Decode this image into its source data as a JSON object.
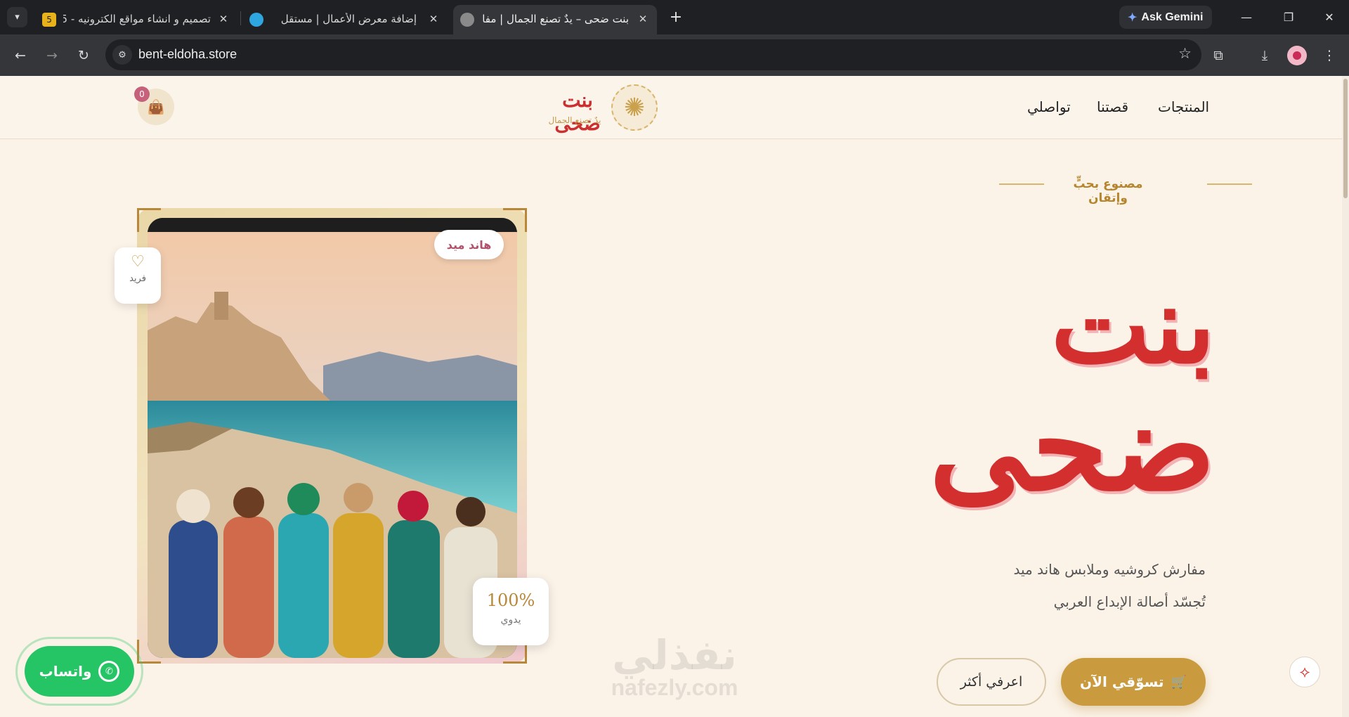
{
  "browser": {
    "tab_list_icon": "chevron-down-icon",
    "tabs": [
      {
        "title": "تصميم و انشاء مواقع الكترونيه - 5",
        "favicon_color": "#e8b21b",
        "badge": "5"
      },
      {
        "title": "إضافة معرض الأعمال | مستقل",
        "favicon_color": "#2ea7e0"
      },
      {
        "title": "بنت ضحى – يدٌ تصنع الجمال | مفا",
        "favicon_color": "#8a8a8a"
      }
    ],
    "new_tab_label": "+",
    "gemini_label": "Ask Gemini",
    "url": "bent-eldoha.store"
  },
  "header": {
    "nav": [
      "المنتجات",
      "قصتنا",
      "تواصلي"
    ],
    "logo_name": "بنت ضحى",
    "logo_tagline": "يدٌ تصنع الجمال",
    "cart_count": "0"
  },
  "hero": {
    "eyebrow": "مصنوع بحبٍّ وإتقان",
    "title_line1": "بنت",
    "title_line2": "ضحى",
    "subtitle_line1": "مفارش كروشيه وملابس هاند ميد",
    "subtitle_line2": "تُجسّد أصالة الإبداع العربي",
    "shop_button": "تسوّقي الآن",
    "more_button": "اعرفي أكثر"
  },
  "image_badges": {
    "handmade": "هاند ميد",
    "unique": "فريد",
    "percent": "100%",
    "manual": "يدوي"
  },
  "whatsapp_label": "واتساب",
  "watermark": {
    "ar": "نفذلي",
    "en": "nafezly.com"
  },
  "colors": {
    "brand_gold": "#c99a3e",
    "brand_red": "#d32f2f",
    "whatsapp_green": "#25c465",
    "page_bg": "#fbf3e8"
  }
}
